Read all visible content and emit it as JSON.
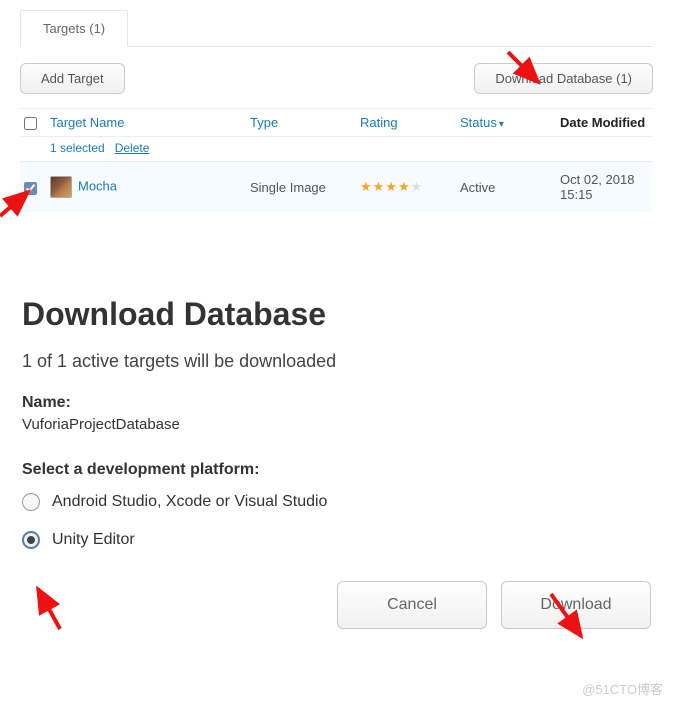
{
  "tab_label": "Targets (1)",
  "buttons": {
    "add_target": "Add Target",
    "download_db": "Download Database (1)",
    "cancel": "Cancel",
    "download": "Download"
  },
  "table": {
    "headers": {
      "name": "Target Name",
      "type": "Type",
      "rating": "Rating",
      "status": "Status",
      "date": "Date Modified"
    },
    "selected_text": "1 selected",
    "delete_text": "Delete",
    "rows": [
      {
        "name": "Mocha",
        "type": "Single Image",
        "rating_stars": 4,
        "rating_max": 5,
        "status": "Active",
        "date": "Oct 02, 2018 15:15",
        "checked": true
      }
    ]
  },
  "dialog": {
    "title": "Download Database",
    "subtitle": "1 of 1 active targets will be downloaded",
    "name_label": "Name:",
    "name_value": "VuforiaProjectDatabase",
    "platform_label": "Select a development platform:",
    "options": [
      {
        "label": "Android Studio, Xcode or Visual Studio",
        "selected": false
      },
      {
        "label": "Unity Editor",
        "selected": true
      }
    ]
  },
  "watermark": "@51CTO博客"
}
